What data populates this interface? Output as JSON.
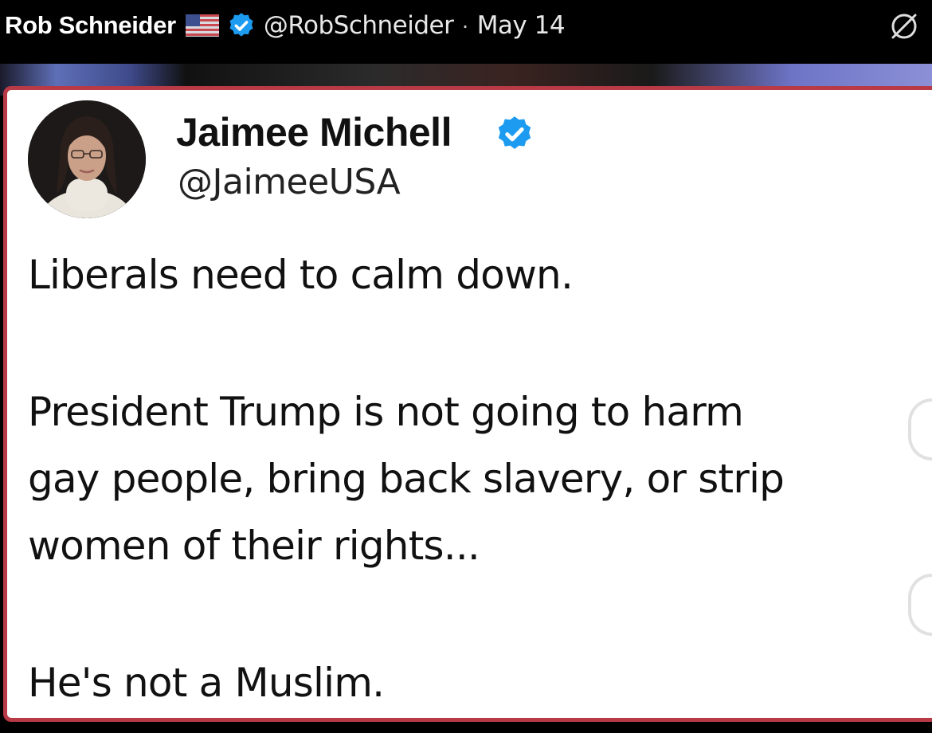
{
  "header": {
    "display_name": "Rob Schneider",
    "handle": "@RobSchneider",
    "separator": "·",
    "date": "May 14",
    "flag_icon": "us-flag-icon",
    "verified_icon": "verified-badge-icon",
    "mute_icon": "muted-icon"
  },
  "quoted_tweet": {
    "author_name": "Jaimee Michell",
    "author_handle": "@JaimeeUSA",
    "verified_icon": "verified-badge-icon",
    "paragraphs": [
      "Liberals need to calm down.",
      "President Trump is not going to harm\ngay people, bring back slavery, or strip\nwomen of their rights...",
      "He's not a Muslim."
    ]
  },
  "colors": {
    "background": "#000000",
    "card_border": "#b93a47",
    "verified_blue": "#1d9bf0"
  }
}
